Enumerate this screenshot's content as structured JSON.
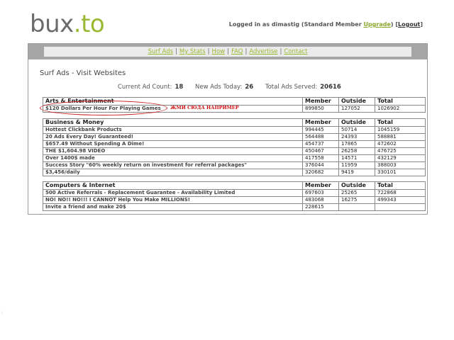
{
  "logo": {
    "part1": "bux",
    "part2": ".to"
  },
  "userbar": {
    "prefix": "Logged in as dimastig (Standard Member ",
    "upgrade": "Upgrade",
    "middle": ") [",
    "logout": "Logout",
    "suffix": "]"
  },
  "nav": {
    "items": [
      "Surf Ads",
      "My Stats",
      "How",
      "FAQ",
      "Advertise",
      "Contact"
    ],
    "separator": "|"
  },
  "page": {
    "heading": "Surf Ads - Visit Websites",
    "current_ad_label": "Current Ad Count:",
    "current_ad_value": "18",
    "new_ads_label": "New Ads Today:",
    "new_ads_value": "26",
    "total_ads_label": "Total Ads Served:",
    "total_ads_value": "20616"
  },
  "annotation": "ЖМИ СЮДА НАПРИМЕР",
  "columns": {
    "member": "Member",
    "outside": "Outside",
    "total": "Total"
  },
  "categories": [
    {
      "name": "Arts & Entertainment",
      "rows": [
        {
          "title": "$120 Dollars Per Hour For Playing Games",
          "member": "899850",
          "outside": "127052",
          "total": "1026902"
        }
      ]
    },
    {
      "name": "Business & Money",
      "rows": [
        {
          "title": "Hottest Clickbank Products",
          "member": "994445",
          "outside": "50714",
          "total": "1045159"
        },
        {
          "title": "20 Ads Every Day! Guaranteed!",
          "member": "564488",
          "outside": "24393",
          "total": "588881"
        },
        {
          "title": "$657.49 Without Spending A Dime!",
          "member": "454737",
          "outside": "17865",
          "total": "472602"
        },
        {
          "title": "THE $1,604.98 VIDEO",
          "member": "450467",
          "outside": "26258",
          "total": "476725"
        },
        {
          "title": "Over 1400$ made",
          "member": "417558",
          "outside": "14571",
          "total": "432129"
        },
        {
          "title": "Success Story \"60% weekly return on investment for referral packages\"",
          "member": "376044",
          "outside": "11959",
          "total": "388003"
        },
        {
          "title": "$3,456/daily",
          "member": "320682",
          "outside": "9419",
          "total": "330101"
        }
      ]
    },
    {
      "name": "Computers & Internet",
      "rows": [
        {
          "title": "500 Active Referrals - Replacement Guarantee - Availability Limited",
          "member": "697603",
          "outside": "25265",
          "total": "722868"
        },
        {
          "title": "NO! NO!! NO!!! I CANNOT Help You Make MILLIONS!",
          "member": "483068",
          "outside": "16275",
          "total": "499343"
        },
        {
          "title": "Invite a friend and make 20$",
          "member": "228615",
          "outside": "",
          "total": ""
        }
      ]
    }
  ]
}
